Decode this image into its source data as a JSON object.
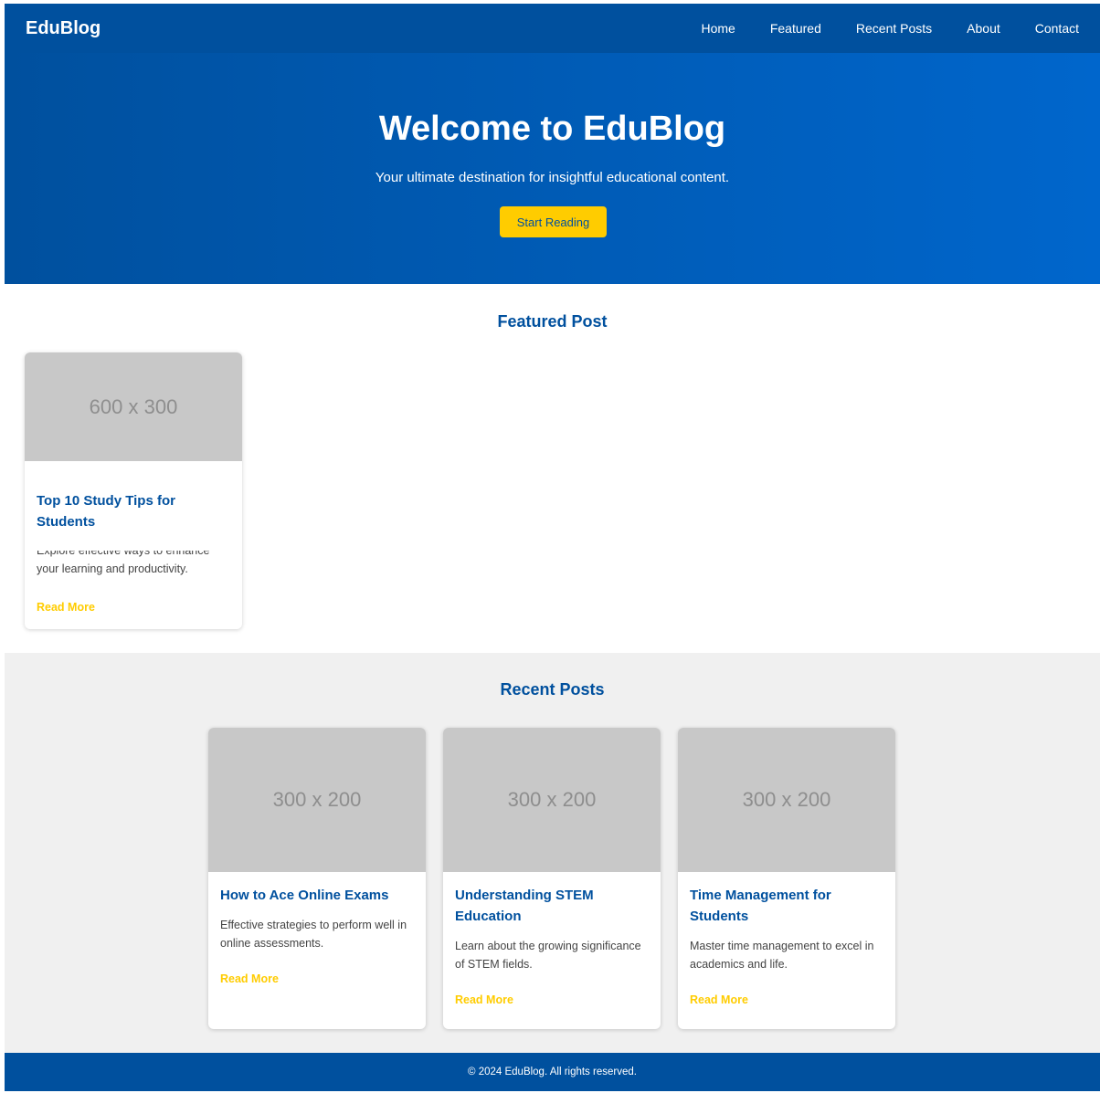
{
  "nav": {
    "logo": "EduBlog",
    "links": [
      "Home",
      "Featured",
      "Recent Posts",
      "About",
      "Contact"
    ]
  },
  "hero": {
    "title": "Welcome to EduBlog",
    "subtitle": "Your ultimate destination for insightful educational content.",
    "button": "Start Reading"
  },
  "featured": {
    "heading": "Featured Post",
    "post": {
      "image_text": "600 x 300",
      "title": "Top 10 Study Tips for Students",
      "description": "Explore effective ways to enhance your learning and productivity.",
      "link": "Read More"
    }
  },
  "recent": {
    "heading": "Recent Posts",
    "posts": [
      {
        "image_text": "300 x 200",
        "title": "How to Ace Online Exams",
        "description": "Effective strategies to perform well in online assessments.",
        "link": "Read More"
      },
      {
        "image_text": "300 x 200",
        "title": "Understanding STEM Education",
        "description": "Learn about the growing significance of STEM fields.",
        "link": "Read More"
      },
      {
        "image_text": "300 x 200",
        "title": "Time Management for Students",
        "description": "Master time management to excel in academics and life.",
        "link": "Read More"
      }
    ]
  },
  "footer": {
    "text": "© 2024 EduBlog. All rights reserved."
  },
  "colors": {
    "primary": "#00509e",
    "accent": "#ffcc00",
    "placeholder": "#c8c8c8",
    "section_bg": "#f0f0f0"
  }
}
